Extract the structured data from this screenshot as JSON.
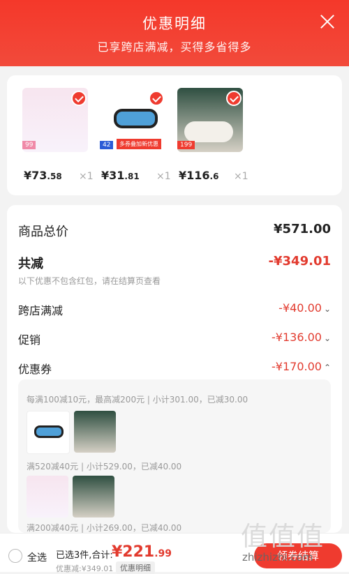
{
  "header": {
    "title": "优惠明细",
    "subtitle": "已享跨店满减，买得多省得多"
  },
  "products": [
    {
      "price": "¥73",
      "decimals": ".58",
      "qty": "×1",
      "tag": "99"
    },
    {
      "price": "¥31",
      "decimals": ".81",
      "qty": "×1",
      "tag": "42",
      "tag2": "多券叠加新优惠"
    },
    {
      "price": "¥116",
      "decimals": ".6",
      "qty": "×1",
      "tag": "199"
    }
  ],
  "summary": {
    "total_label": "商品总价",
    "total_value": "¥571.00",
    "reduce_label": "共减",
    "reduce_value": "-¥349.01",
    "note": "以下优惠不包含红包，请在结算页查看",
    "cross_store_label": "跨店满减",
    "cross_store_value": "-¥40.00",
    "promotion_label": "促销",
    "promotion_value": "-¥136.00",
    "coupon_label": "优惠券",
    "coupon_value": "-¥170.00"
  },
  "coupons": [
    "每满100减10元，最高减200元 | 小计301.00，已减30.00",
    "满520减40元 | 小计529.00，已减40.00",
    "满200减40元 | 小计269.00，已减40.00"
  ],
  "footer": {
    "select_all": "全选",
    "selected": "已选3件,合计:",
    "total_main": "¥221",
    "total_dec": ".99",
    "discount": "优惠减:¥349.01",
    "detail": "优惠明细",
    "button": "领券结算"
  },
  "watermark": {
    "logo": "值值值",
    "url": "zhizhizhi.com"
  }
}
